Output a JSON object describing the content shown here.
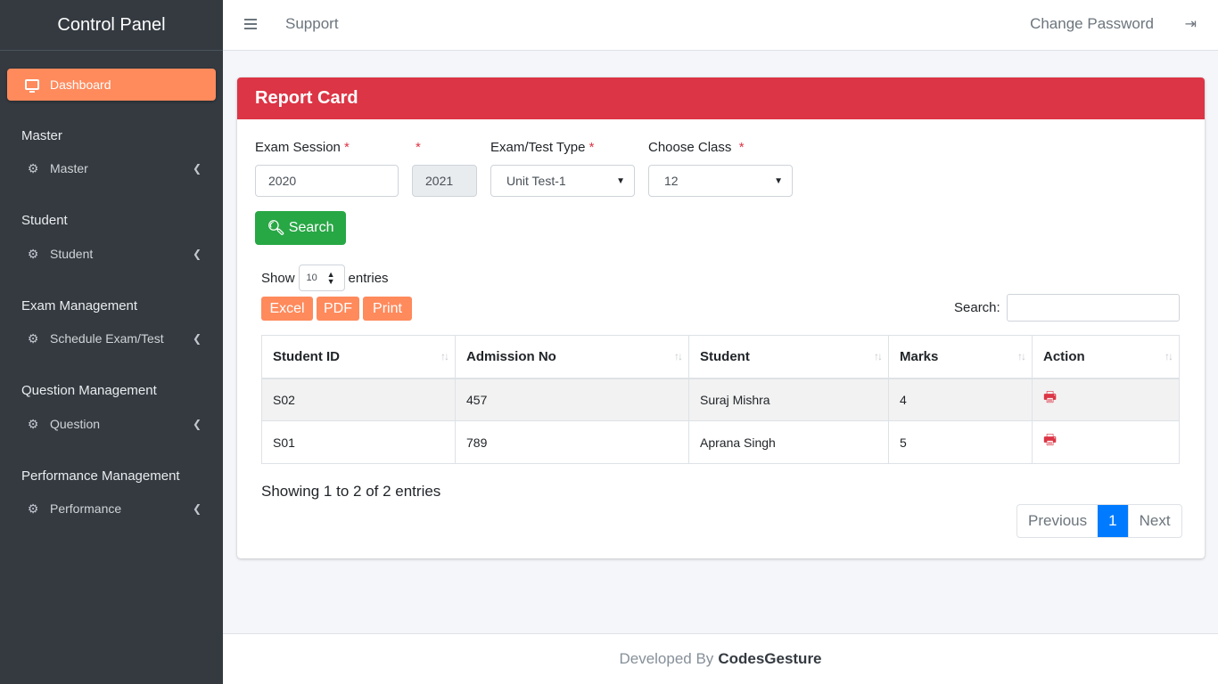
{
  "brand": "Control Panel",
  "sidebar": {
    "dashboard": "Dashboard",
    "sections": [
      {
        "header": "Master",
        "item": "Master"
      },
      {
        "header": "Student",
        "item": "Student"
      },
      {
        "header": "Exam Management",
        "item": "Schedule Exam/Test"
      },
      {
        "header": "Question Management",
        "item": "Question"
      },
      {
        "header": "Performance Management",
        "item": "Performance"
      }
    ]
  },
  "topbar": {
    "support": "Support",
    "change_password": "Change Password"
  },
  "card": {
    "title": "Report Card",
    "fields": {
      "exam_session_label": "Exam Session",
      "exam_session_value": "2020",
      "session_to_value": "2021",
      "exam_type_label": "Exam/Test Type",
      "exam_type_value": "Unit Test-1",
      "class_label": "Choose Class",
      "class_value": "12",
      "required_mark": "*"
    },
    "search_button": "Search",
    "show_label": "Show",
    "entries_value": "10",
    "entries_label": "entries",
    "export": {
      "excel": "Excel",
      "pdf": "PDF",
      "print": "Print"
    },
    "search_label": "Search:",
    "table": {
      "headers": [
        "Student ID",
        "Admission No",
        "Student",
        "Marks",
        "Action"
      ],
      "rows": [
        {
          "id": "S02",
          "admission": "457",
          "student": "Suraj Mishra",
          "marks": "4"
        },
        {
          "id": "S01",
          "admission": "789",
          "student": "Aprana Singh",
          "marks": "5"
        }
      ]
    },
    "info": "Showing 1 to 2 of 2 entries",
    "pager": {
      "previous": "Previous",
      "current": "1",
      "next": "Next"
    }
  },
  "footer": {
    "prefix": "Developed By",
    "company": "CodesGesture"
  },
  "colors": {
    "sidebar": "#343a40",
    "accent": "#ff8a5c",
    "header": "#dc3545",
    "success": "#28a745",
    "primary": "#007bff"
  }
}
